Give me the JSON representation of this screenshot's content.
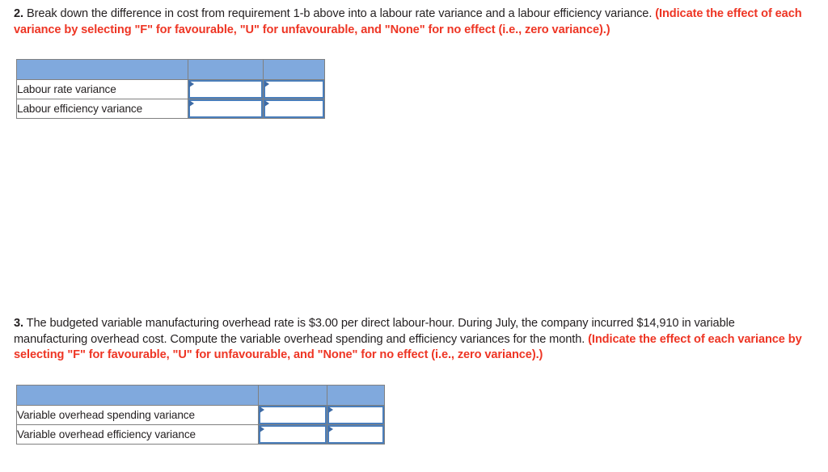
{
  "questions": [
    {
      "number": "2.",
      "body": " Break down the difference in cost from requirement 1-b above into a labour rate variance and a labour efficiency variance. ",
      "note": "(Indicate the effect of each variance by selecting \"F\" for favourable, \"U\" for unfavourable, and \"None\" for no effect (i.e., zero variance).)"
    },
    {
      "number": "3.",
      "body": " The budgeted variable manufacturing overhead rate is $3.00 per direct labour-hour. During July, the company incurred $14,910 in variable manufacturing overhead cost. Compute the variable overhead spending and efficiency variances for the month. ",
      "note": "(Indicate the effect of each variance by selecting \"F\" for favourable, \"U\" for unfavourable, and \"None\" for no effect (i.e., zero variance).)"
    }
  ],
  "tables": [
    {
      "name": "labour-variance-table",
      "headers": [
        "",
        "",
        ""
      ],
      "rows": [
        {
          "label": "Labour rate variance",
          "amount": "",
          "effect": ""
        },
        {
          "label": "Labour efficiency variance",
          "amount": "",
          "effect": ""
        }
      ]
    },
    {
      "name": "variable-overhead-variance-table",
      "headers": [
        "",
        "",
        ""
      ],
      "rows": [
        {
          "label": "Variable overhead spending variance",
          "amount": "",
          "effect": ""
        },
        {
          "label": "Variable overhead efficiency variance",
          "amount": "",
          "effect": ""
        }
      ]
    }
  ],
  "colors": {
    "header_blue": "#80a9dd",
    "note_red": "#ee3524",
    "input_border_blue": "#4a7ebb",
    "table_border_gray": "#808080",
    "text": "#231f20"
  }
}
